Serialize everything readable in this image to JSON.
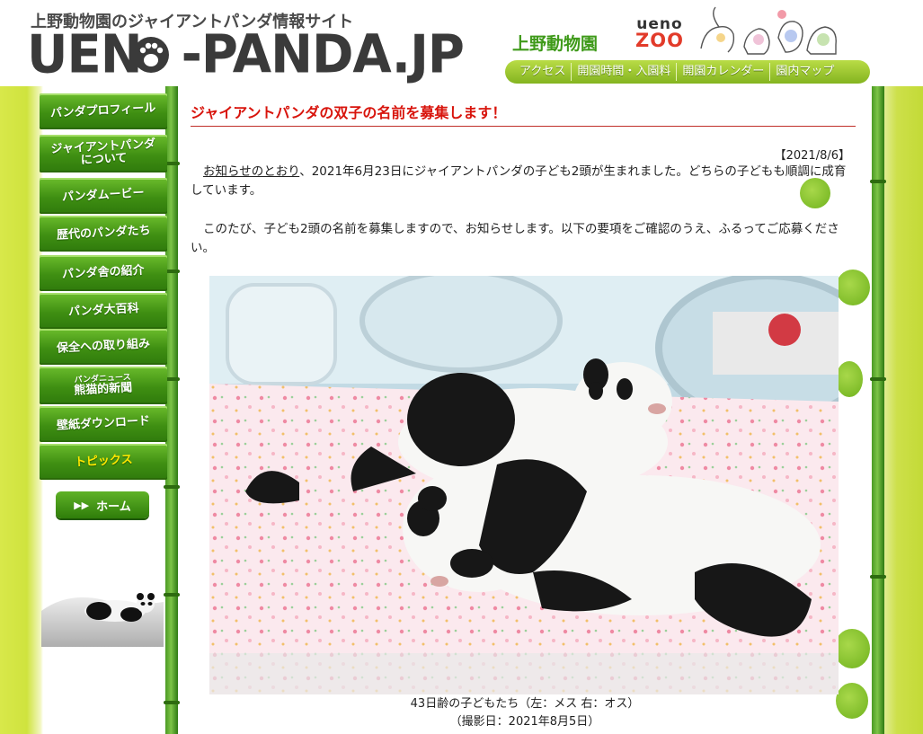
{
  "header": {
    "tagline": "上野動物園のジャイアントパンダ情報サイト",
    "logo_text_a": "UEN",
    "logo_text_b": "-PANDA.JP",
    "zoo_name": "上野動物園",
    "zoo_logo_line1": "ueno",
    "zoo_logo_line2": "ZOO",
    "nav": [
      "アクセス",
      "開園時間・入園料",
      "開園カレンダー",
      "園内マップ"
    ]
  },
  "sidebar": {
    "items": [
      {
        "label": "パンダプロフィール"
      },
      {
        "label": "ジャイアントパンダ",
        "label2": "について"
      },
      {
        "label": "パンダムービー"
      },
      {
        "label": "歴代のパンダたち"
      },
      {
        "label": "パンダ舎の紹介"
      },
      {
        "label": "パンダ大百科"
      },
      {
        "label": "保全への取り組み"
      },
      {
        "small": "パンダニュース",
        "label": "熊猫的新聞"
      },
      {
        "label": "壁紙ダウンロード"
      },
      {
        "label": "トピックス"
      }
    ],
    "home_label": "ホーム",
    "home_icon": "▶▶"
  },
  "article": {
    "title": "ジャイアントパンダの双子の名前を募集します！",
    "date": "【2021/8/6】",
    "para1_link": "お知らせのとおり",
    "para1_rest": "、2021年6月23日にジャイアントパンダの子ども2頭が生まれました。どちらの子どもも順調に成育しています。",
    "para2": "このたび、子ども2頭の名前を募集しますので、お知らせします。以下の要項をご確認のうえ、ふるってご応募ください。",
    "caption1": "43日齢の子どもたち（左：メス 右：オス）",
    "caption2": "（撮影日：2021年8月5日）"
  },
  "colors": {
    "accent_green": "#3f8f12",
    "title_red": "#d8140c",
    "active_yellow": "#ffe600"
  }
}
